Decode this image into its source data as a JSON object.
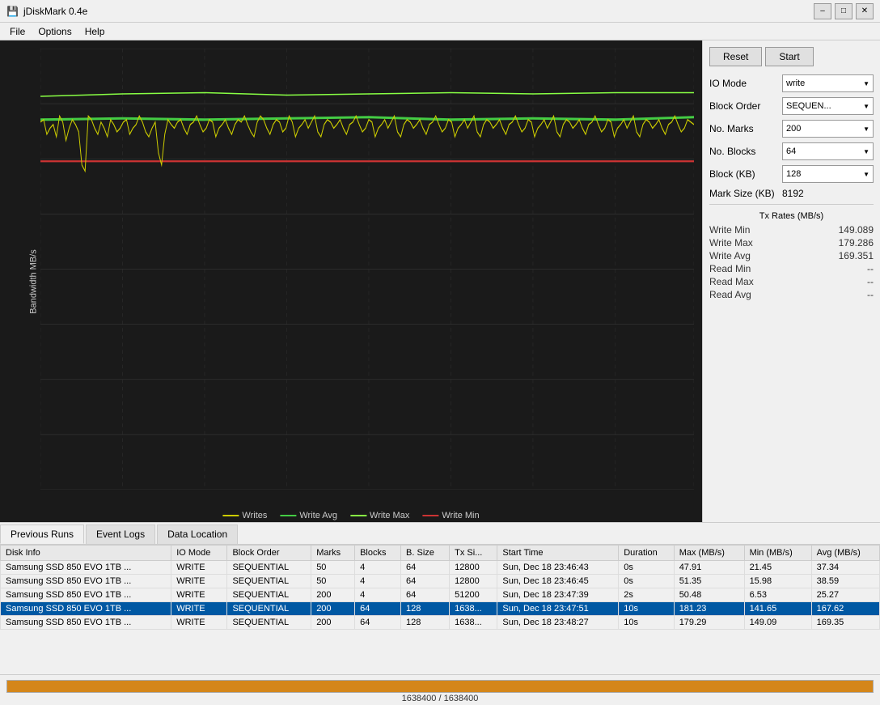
{
  "title": {
    "icon": "💾",
    "text": "jDiskMark 0.4e"
  },
  "titlebar_controls": {
    "minimize": "–",
    "maximize": "□",
    "close": "✕"
  },
  "menu": {
    "items": [
      "File",
      "Options",
      "Help"
    ]
  },
  "right_panel": {
    "reset_label": "Reset",
    "start_label": "Start",
    "io_mode_label": "IO Mode",
    "io_mode_value": "write",
    "block_order_label": "Block Order",
    "block_order_value": "SEQUEN...",
    "no_marks_label": "No. Marks",
    "no_marks_value": "200",
    "no_blocks_label": "No. Blocks",
    "no_blocks_value": "64",
    "block_kb_label": "Block (KB)",
    "block_kb_value": "128",
    "mark_size_label": "Mark Size (KB)",
    "mark_size_value": "8192",
    "tx_rates_label": "Tx Rates (MB/s)",
    "write_min_label": "Write Min",
    "write_min_value": "149.089",
    "write_max_label": "Write Max",
    "write_max_value": "179.286",
    "write_avg_label": "Write Avg",
    "write_avg_value": "169.351",
    "read_min_label": "Read Min",
    "read_min_value": "--",
    "read_max_label": "Read Max",
    "read_max_value": "--",
    "read_avg_label": "Read Avg",
    "read_avg_value": "--"
  },
  "y_axis_label": "Bandwidth MB/s",
  "legend": {
    "writes_label": "Writes",
    "write_avg_label": "Write Avg",
    "write_max_label": "Write Max",
    "write_min_label": "Write Min"
  },
  "tabs": [
    {
      "id": "previous-runs",
      "label": "Previous Runs",
      "active": true
    },
    {
      "id": "event-logs",
      "label": "Event Logs",
      "active": false
    },
    {
      "id": "data-location",
      "label": "Data Location",
      "active": false
    }
  ],
  "table": {
    "headers": [
      "Disk Info",
      "IO Mode",
      "Block Order",
      "Marks",
      "Blocks",
      "B. Size",
      "Tx Si...",
      "Start Time",
      "Duration",
      "Max (MB/s)",
      "Min (MB/s)",
      "Avg (MB/s)"
    ],
    "rows": [
      {
        "disk": "Samsung SSD 850 EVO 1TB ...",
        "io_mode": "WRITE",
        "block_order": "SEQUENTIAL",
        "marks": "50",
        "blocks": "4",
        "b_size": "64",
        "tx_size": "12800",
        "start_time": "Sun, Dec 18 23:46:43",
        "duration": "0s",
        "max": "47.91",
        "min": "21.45",
        "avg": "37.34",
        "selected": false
      },
      {
        "disk": "Samsung SSD 850 EVO 1TB ...",
        "io_mode": "WRITE",
        "block_order": "SEQUENTIAL",
        "marks": "50",
        "blocks": "4",
        "b_size": "64",
        "tx_size": "12800",
        "start_time": "Sun, Dec 18 23:46:45",
        "duration": "0s",
        "max": "51.35",
        "min": "15.98",
        "avg": "38.59",
        "selected": false
      },
      {
        "disk": "Samsung SSD 850 EVO 1TB ...",
        "io_mode": "WRITE",
        "block_order": "SEQUENTIAL",
        "marks": "200",
        "blocks": "4",
        "b_size": "64",
        "tx_size": "51200",
        "start_time": "Sun, Dec 18 23:47:39",
        "duration": "2s",
        "max": "50.48",
        "min": "6.53",
        "avg": "25.27",
        "selected": false
      },
      {
        "disk": "Samsung SSD 850 EVO 1TB ...",
        "io_mode": "WRITE",
        "block_order": "SEQUENTIAL",
        "marks": "200",
        "blocks": "64",
        "b_size": "128",
        "tx_size": "1638...",
        "start_time": "Sun, Dec 18 23:47:51",
        "duration": "10s",
        "max": "181.23",
        "min": "141.65",
        "avg": "167.62",
        "selected": true
      },
      {
        "disk": "Samsung SSD 850 EVO 1TB ...",
        "io_mode": "WRITE",
        "block_order": "SEQUENTIAL",
        "marks": "200",
        "blocks": "64",
        "b_size": "128",
        "tx_size": "1638...",
        "start_time": "Sun, Dec 18 23:48:27",
        "duration": "10s",
        "max": "179.29",
        "min": "149.09",
        "avg": "169.35",
        "selected": false
      }
    ]
  },
  "progress": {
    "label": "1638400 / 1638400",
    "percent": 100
  }
}
